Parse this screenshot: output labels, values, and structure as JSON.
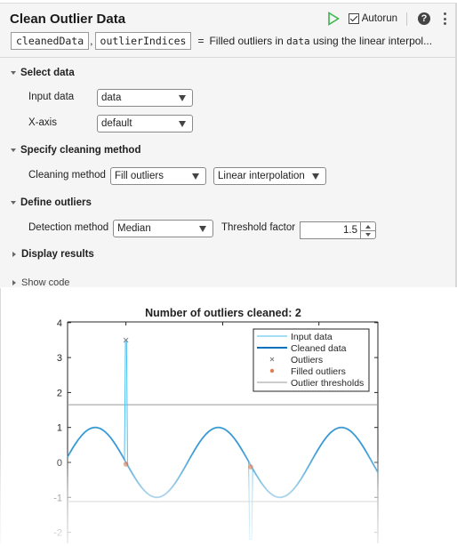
{
  "task": {
    "title": "Clean Outlier Data",
    "toolbar": {
      "run_icon": "play-icon",
      "autorun_label": "Autorun",
      "autorun_checked": true,
      "help_icon": "help-icon",
      "more_icon": "more-options-icon"
    },
    "outputs": {
      "vars": [
        "cleanedData",
        "outlierIndices"
      ],
      "comma": ",",
      "equals": "=",
      "summary_pre": "Filled outliers in ",
      "summary_code": "data",
      "summary_post": " using the linear interpol..."
    },
    "sections": {
      "select_data": {
        "label": "Select data",
        "expanded": true,
        "input_data_label": "Input data",
        "input_data_value": "data",
        "xaxis_label": "X-axis",
        "xaxis_value": "default"
      },
      "cleaning_method": {
        "label": "Specify cleaning method",
        "expanded": true,
        "method_label": "Cleaning method",
        "method_value": "Fill outliers",
        "fill_value": "Linear interpolation"
      },
      "define_outliers": {
        "label": "Define outliers",
        "expanded": true,
        "detection_label": "Detection method",
        "detection_value": "Median",
        "threshold_label": "Threshold factor",
        "threshold_value": "1.5"
      },
      "display_results": {
        "label": "Display results",
        "expanded": false
      }
    },
    "show_code_label": "Show code"
  },
  "colors": {
    "input_data": "#4dbeee",
    "cleaned_data": "#0072bd",
    "outliers": "#7f7f7f",
    "filled_outliers": "#d95319",
    "thresholds": "#999999",
    "run_icon": "#3cb54a"
  },
  "chart_data": {
    "type": "line",
    "title": "Number of outliers cleaned: 2",
    "xlabel": "",
    "ylabel": "",
    "ylim": [
      -2.2,
      4
    ],
    "yticks": [
      "4",
      "3",
      "2",
      "1",
      "0",
      "-1",
      "-2"
    ],
    "ytick_values": [
      4,
      3,
      2,
      1,
      0,
      -1,
      -2
    ],
    "xlim": [
      0,
      1
    ],
    "grid": false,
    "legend_placement": "top-right",
    "legend": [
      "Input data",
      "Cleaned data",
      "Outliers",
      "Filled outliers",
      "Outlier thresholds"
    ],
    "series": [
      {
        "name": "Cleaned data",
        "description": "sine wave, amplitude 1, ~2.5 periods across the axis",
        "amplitude": 1,
        "periods": 2.52,
        "phase_start_value": 0.16
      },
      {
        "name": "Input data",
        "description": "same sine wave with two spike outliers",
        "spikes": [
          {
            "x_frac": 0.188,
            "y": 3.5
          },
          {
            "x_frac": 0.59,
            "y": -2.2
          }
        ]
      },
      {
        "name": "Outliers",
        "points": [
          {
            "x_frac": 0.188,
            "y": 3.5
          }
        ]
      },
      {
        "name": "Filled outliers",
        "points": [
          {
            "x_frac": 0.188,
            "y": -0.05
          },
          {
            "x_frac": 0.59,
            "y": -0.13
          }
        ]
      },
      {
        "name": "Outlier thresholds",
        "values": [
          1.65,
          -1.12
        ]
      }
    ]
  }
}
